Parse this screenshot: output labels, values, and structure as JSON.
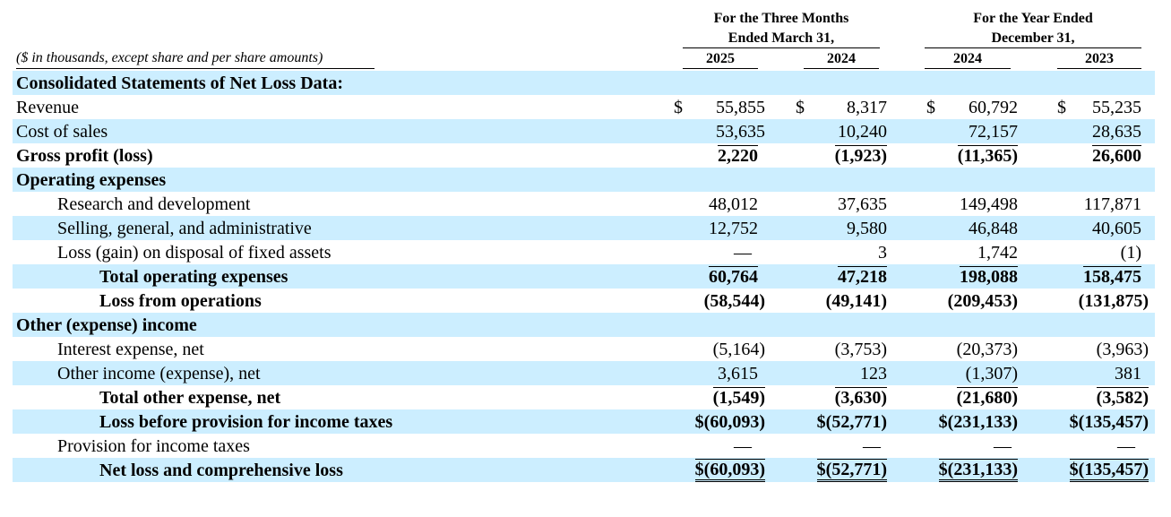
{
  "header": {
    "group1": [
      "For the Three Months",
      "Ended March 31,"
    ],
    "group2": [
      "For the Year Ended",
      "December 31,"
    ],
    "caption": "($ in thousands, except share and per share amounts)",
    "years": [
      "2025",
      "2024",
      "2024",
      "2023"
    ]
  },
  "rows": [
    {
      "label": "Consolidated Statements of Net Loss Data:",
      "values": [
        "",
        "",
        "",
        ""
      ]
    },
    {
      "label": "Revenue",
      "values": [
        "55,855",
        "8,317",
        "60,792",
        "55,235"
      ],
      "dollar": true
    },
    {
      "label": "Cost of sales",
      "values": [
        "53,635",
        "10,240",
        "72,157",
        "28,635"
      ]
    },
    {
      "label": "Gross profit (loss)",
      "values": [
        "2,220",
        "(1,923)",
        "(11,365)",
        "26,600"
      ]
    },
    {
      "label": "Operating expenses",
      "values": [
        "",
        "",
        "",
        ""
      ]
    },
    {
      "label": "Research and development",
      "values": [
        "48,012",
        "37,635",
        "149,498",
        "117,871"
      ]
    },
    {
      "label": "Selling, general, and administrative",
      "values": [
        "12,752",
        "9,580",
        "46,848",
        "40,605"
      ]
    },
    {
      "label": "Loss (gain) on disposal of fixed assets",
      "values": [
        "—",
        "3",
        "1,742",
        "(1)"
      ]
    },
    {
      "label": "Total operating expenses",
      "values": [
        "60,764",
        "47,218",
        "198,088",
        "158,475"
      ]
    },
    {
      "label": "Loss from operations",
      "values": [
        "(58,544)",
        "(49,141)",
        "(209,453)",
        "(131,875)"
      ]
    },
    {
      "label": "Other (expense) income",
      "values": [
        "",
        "",
        "",
        ""
      ]
    },
    {
      "label": "Interest expense, net",
      "values": [
        "(5,164)",
        "(3,753)",
        "(20,373)",
        "(3,963)"
      ]
    },
    {
      "label": "Other income (expense), net",
      "values": [
        "3,615",
        "123",
        "(1,307)",
        "381"
      ]
    },
    {
      "label": "Total other expense, net",
      "values": [
        "(1,549)",
        "(3,630)",
        "(21,680)",
        "(3,582)"
      ]
    },
    {
      "label": "Loss before provision for income taxes",
      "values": [
        "$(60,093)",
        "$(52,771)",
        "$(231,133)",
        "$(135,457)"
      ]
    },
    {
      "label": "Provision for income taxes",
      "values": [
        "—",
        "—",
        "—",
        "—"
      ]
    },
    {
      "label": "Net loss and comprehensive loss",
      "values": [
        "$(60,093)",
        "$(52,771)",
        "$(231,133)",
        "$(135,457)"
      ]
    }
  ],
  "dollar_sign": "$"
}
